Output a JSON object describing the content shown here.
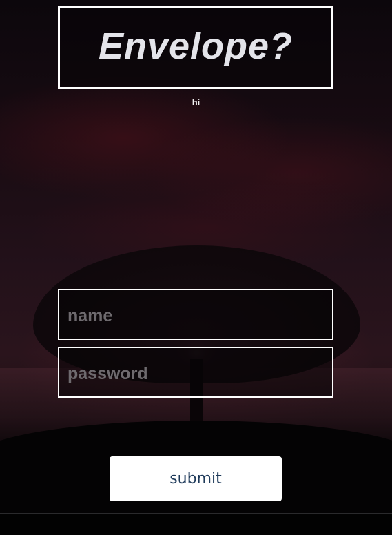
{
  "header": {
    "title": "Envelope?",
    "subtitle": "hi"
  },
  "form": {
    "name_placeholder": "name",
    "password_placeholder": "password",
    "submit_label": "submit"
  },
  "colors": {
    "accent_text": "#1e3a5a",
    "border": "#ffffff",
    "title_text": "#e4e4ea"
  }
}
